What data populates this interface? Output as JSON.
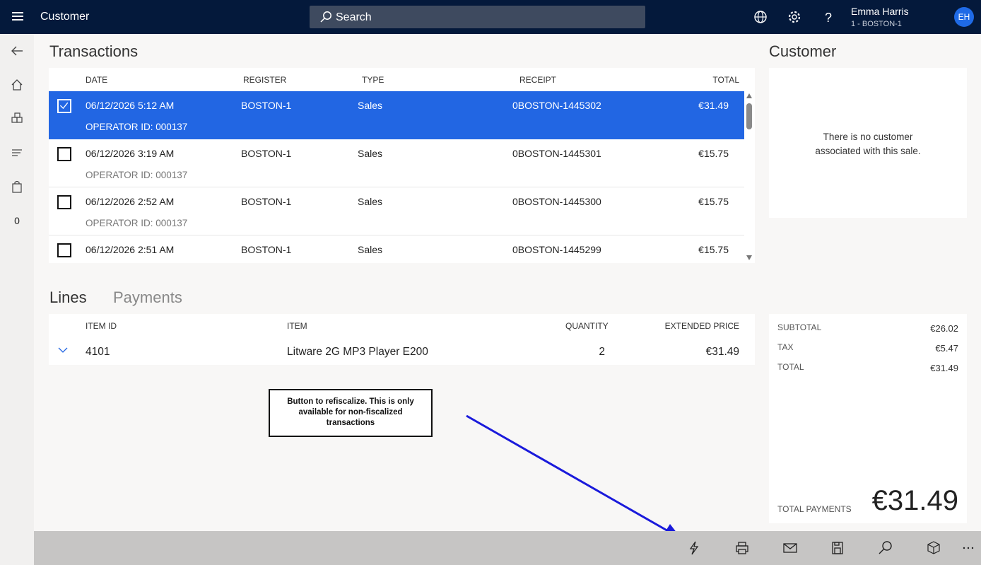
{
  "header": {
    "title": "Customer",
    "search_placeholder": "Search",
    "user_name": "Emma Harris",
    "user_store": "1 - BOSTON-1",
    "avatar_initials": "EH"
  },
  "leftnav": {
    "cart_count": "0"
  },
  "transactions": {
    "title": "Transactions",
    "columns": [
      "DATE",
      "REGISTER",
      "TYPE",
      "RECEIPT",
      "TOTAL"
    ],
    "rows": [
      {
        "date": "06/12/2026 5:12 AM",
        "register": "BOSTON-1",
        "type": "Sales",
        "receipt": "0BOSTON-1445302",
        "total": "€31.49",
        "operator": "OPERATOR ID: 000137",
        "selected": true
      },
      {
        "date": "06/12/2026 3:19 AM",
        "register": "BOSTON-1",
        "type": "Sales",
        "receipt": "0BOSTON-1445301",
        "total": "€15.75",
        "operator": "OPERATOR ID: 000137",
        "selected": false
      },
      {
        "date": "06/12/2026 2:52 AM",
        "register": "BOSTON-1",
        "type": "Sales",
        "receipt": "0BOSTON-1445300",
        "total": "€15.75",
        "operator": "OPERATOR ID: 000137",
        "selected": false
      },
      {
        "date": "06/12/2026 2:51 AM",
        "register": "BOSTON-1",
        "type": "Sales",
        "receipt": "0BOSTON-1445299",
        "total": "€15.75",
        "operator": "",
        "selected": false
      }
    ]
  },
  "tabs": {
    "lines": "Lines",
    "payments": "Payments"
  },
  "lines": {
    "columns": [
      "ITEM ID",
      "ITEM",
      "QUANTITY",
      "EXTENDED PRICE"
    ],
    "rows": [
      {
        "item_id": "4101",
        "item": "Litware 2G MP3 Player E200",
        "quantity": "2",
        "price": "€31.49"
      }
    ]
  },
  "customer": {
    "title": "Customer",
    "empty_line1": "There is no customer",
    "empty_line2": "associated with this sale."
  },
  "totals": {
    "subtotal_label": "SUBTOTAL",
    "subtotal": "€26.02",
    "tax_label": "TAX",
    "tax": "€5.47",
    "total_label": "TOTAL",
    "total": "€31.49",
    "payments_label": "TOTAL PAYMENTS",
    "payments": "€31.49"
  },
  "annotation": {
    "text": "Button to refiscalize. This is only available for non-fiscalized transactions",
    "arrow_color": "#1a1adb"
  },
  "appbar": {
    "buttons": [
      "refiscalize-icon",
      "print-icon",
      "email-icon",
      "save-icon",
      "search-icon",
      "return-icon",
      "more-icon"
    ]
  },
  "colors": {
    "topbar": "#04193b",
    "accent": "#2266e3",
    "appbar": "#c6c5c4"
  }
}
